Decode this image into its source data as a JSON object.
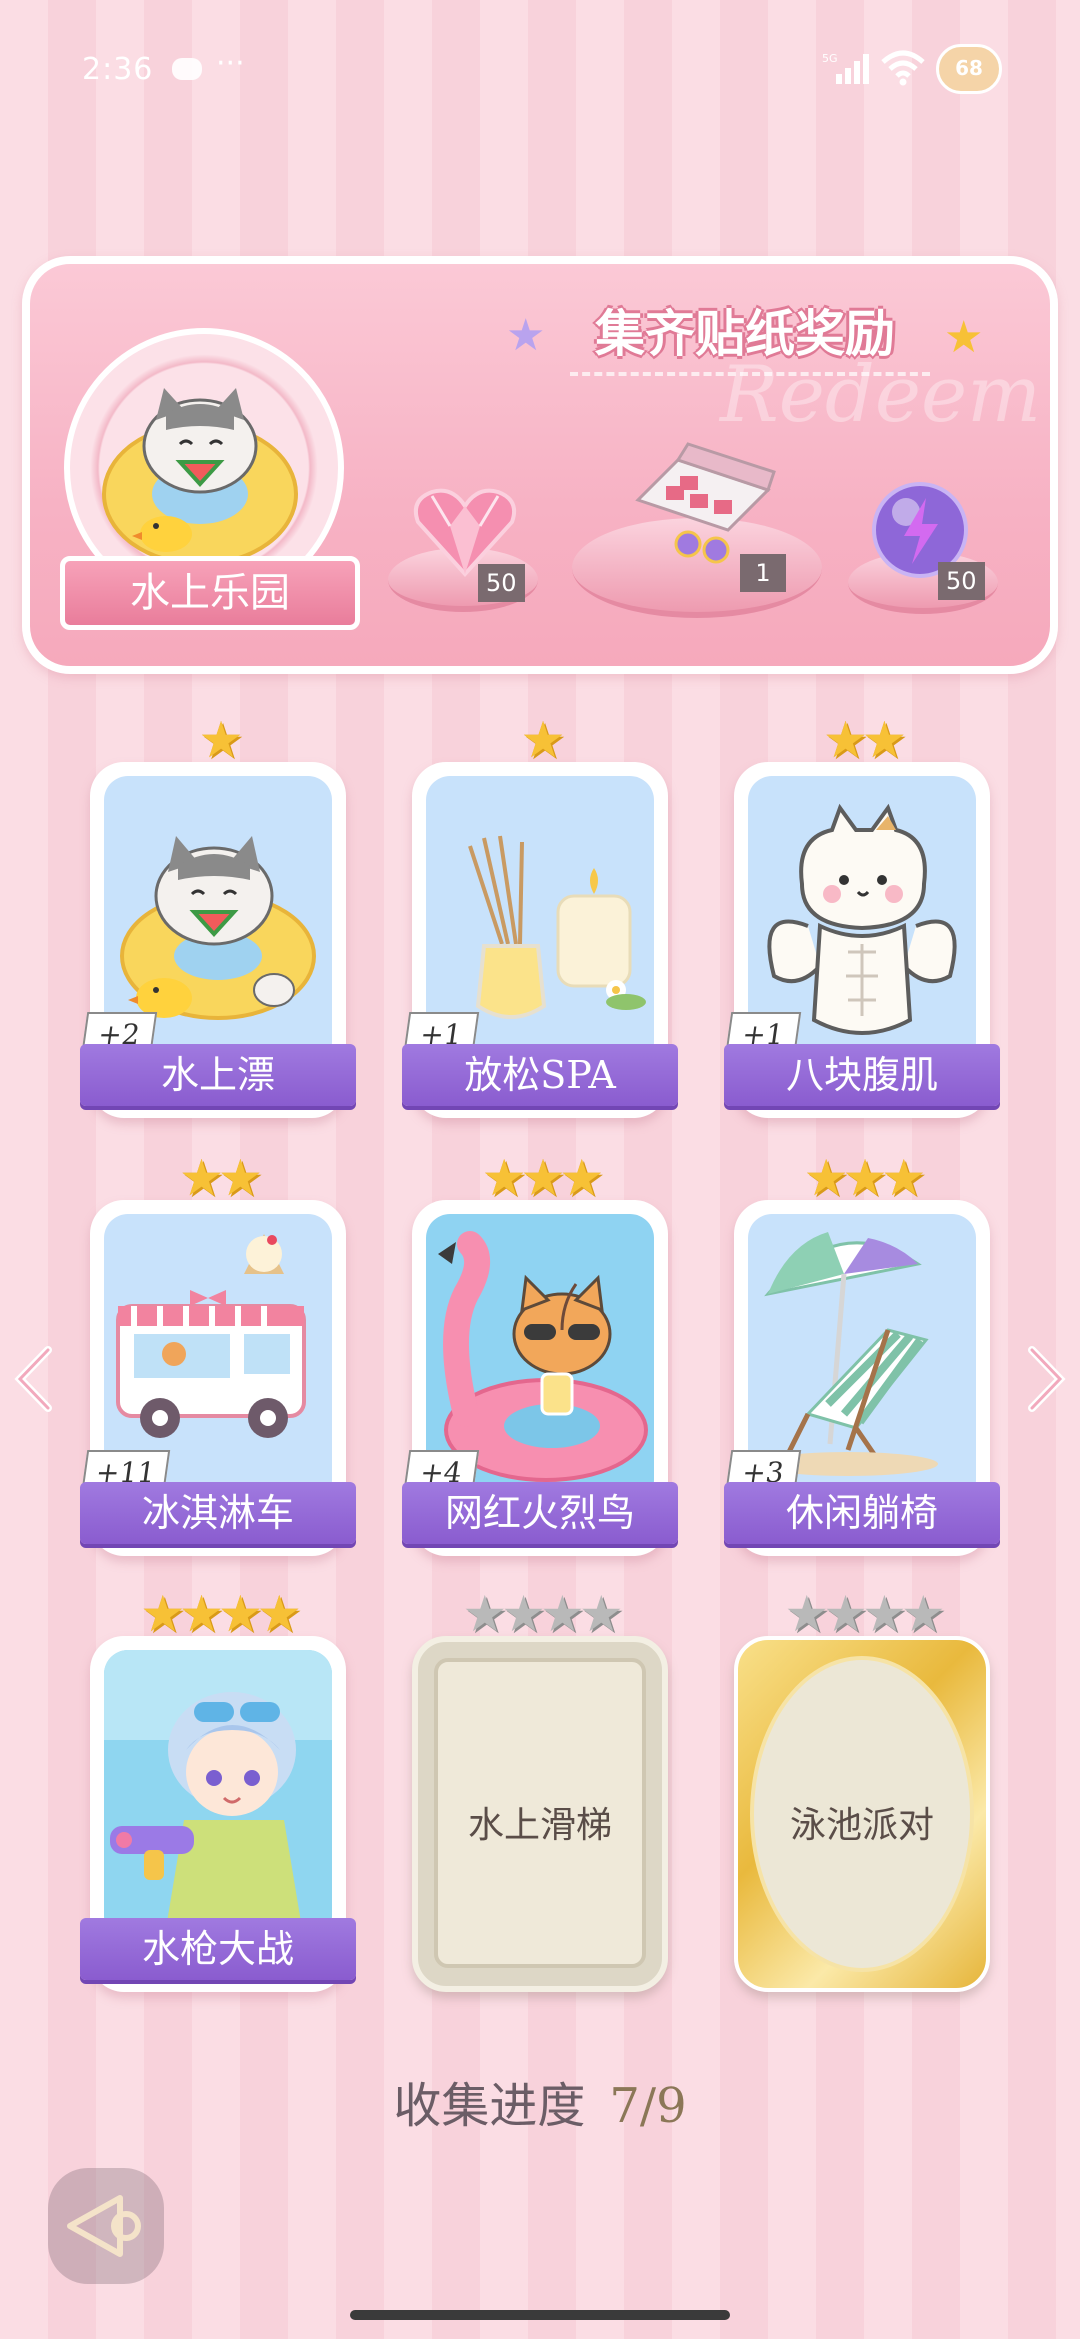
{
  "status_bar": {
    "time": "2:36",
    "menu": "···",
    "network": "5G",
    "battery": "68"
  },
  "banner": {
    "title": "集齐贴纸奖励",
    "watermark": "Redeem",
    "theme_label": "水上乐园",
    "rewards": [
      {
        "icon": "pink-heart-gem-icon",
        "count": "50"
      },
      {
        "icon": "gift-box-icon",
        "count": "1"
      },
      {
        "icon": "purple-energy-orb-icon",
        "count": "50"
      }
    ]
  },
  "cards": [
    {
      "name": "水上漂",
      "stars": 1,
      "bonus": "+2",
      "art": "cat-swim-ring-art"
    },
    {
      "name": "放松SPA",
      "stars": 1,
      "bonus": "+1",
      "art": "aroma-candle-art"
    },
    {
      "name": "八块腹肌",
      "stars": 2,
      "bonus": "+1",
      "art": "muscle-cat-art"
    },
    {
      "name": "冰淇淋车",
      "stars": 2,
      "bonus": "+11",
      "art": "ice-cream-truck-art"
    },
    {
      "name": "网红火烈鸟",
      "stars": 3,
      "bonus": "+4",
      "art": "flamingo-float-cat-art"
    },
    {
      "name": "休闲躺椅",
      "stars": 3,
      "bonus": "+3",
      "art": "beach-chair-umbrella-art"
    },
    {
      "name": "水枪大战",
      "stars": 4,
      "bonus": "",
      "art": "water-gun-boy-art"
    },
    {
      "name": "水上滑梯",
      "stars": 4,
      "locked": true
    },
    {
      "name": "泳池派对",
      "stars": 4,
      "locked": true
    }
  ],
  "progress": {
    "label": "收集进度",
    "value": "7/9"
  },
  "colors": {
    "accent_purple": "#8a5ccf",
    "pink_bg": "#fbdde4",
    "star_gold": "#f7c136"
  }
}
